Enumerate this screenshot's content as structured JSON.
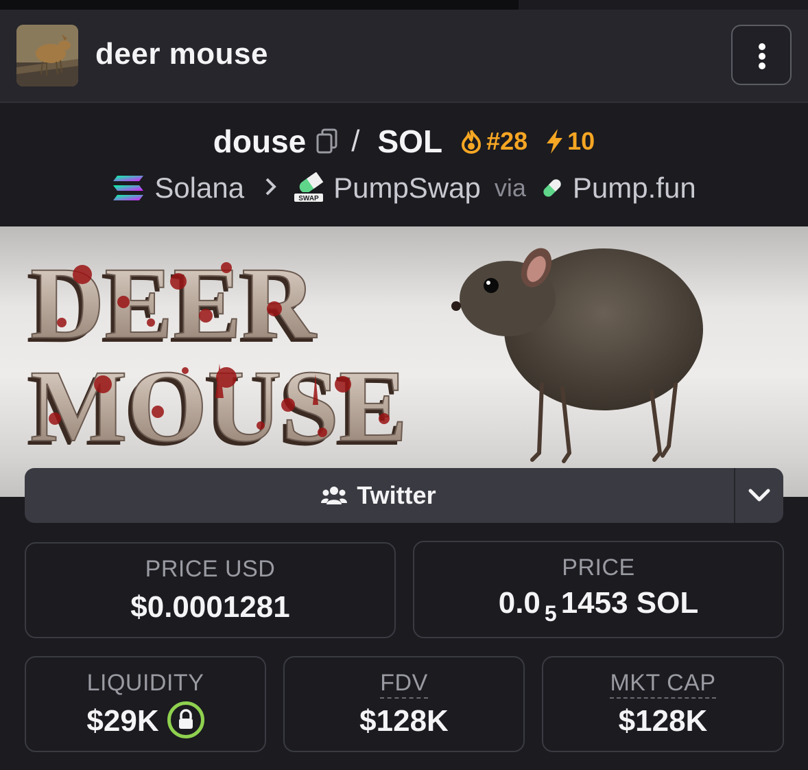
{
  "header": {
    "title": "deer mouse",
    "avatar_alt": "token avatar",
    "menu_icon": "more-vertical-icon"
  },
  "pair": {
    "base": "douse",
    "separator": "/",
    "quote": "SOL",
    "rank": "#28",
    "boosts": "10",
    "chain": "Solana",
    "dex": "PumpSwap",
    "via": "via",
    "launchpad": "Pump.fun",
    "dex_badge": "SWAP"
  },
  "banner": {
    "line1": "DEER",
    "line2": "MOUSE"
  },
  "social": {
    "twitter_label": "Twitter"
  },
  "stats": {
    "price_usd_label": "PRICE USD",
    "price_usd_value": "$0.0001281",
    "price_label": "PRICE",
    "price_prefix": "0.0",
    "price_zeros": "5",
    "price_digits": "1453 SOL",
    "liquidity_label": "LIQUIDITY",
    "liquidity_value": "$29K",
    "fdv_label": "FDV",
    "fdv_value": "$128K",
    "mktcap_label": "MKT CAP",
    "mktcap_value": "$128K"
  },
  "colors": {
    "accent_orange": "#f5a623",
    "lock_green": "#8fd14f",
    "background": "#1b1b20"
  }
}
